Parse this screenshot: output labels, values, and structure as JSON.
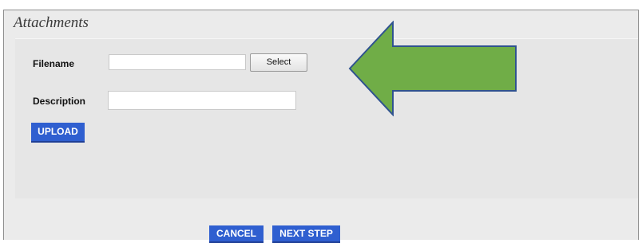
{
  "section": {
    "title": "Attachments"
  },
  "form": {
    "filename_label": "Filename",
    "filename_value": "",
    "select_label": "Select",
    "description_label": "Description",
    "description_value": "",
    "upload_label": "UPLOAD"
  },
  "footer": {
    "cancel_label": "CANCEL",
    "next_label": "NEXT STEP"
  },
  "colors": {
    "arrow_fill": "#70ad47",
    "arrow_stroke": "#2f528f",
    "button_blue": "#2f5fd0",
    "panel_bg": "#ebebeb"
  },
  "icons": {
    "pointer": "left-arrow-icon"
  }
}
